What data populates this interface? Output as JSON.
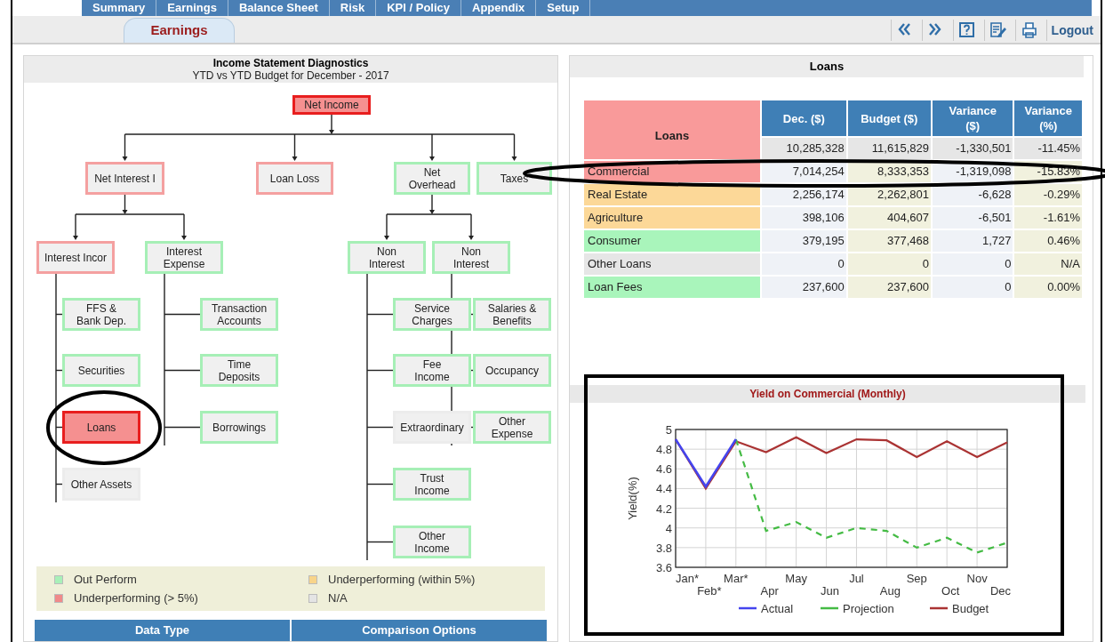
{
  "nav_tabs": [
    "Summary",
    "Earnings",
    "Balance Sheet",
    "Risk",
    "KPI / Policy",
    "Appendix",
    "Setup"
  ],
  "sub_tab": {
    "label": "Earnings",
    "selected": true
  },
  "toolbar": {
    "buttons": [
      {
        "kind": "prev"
      },
      {
        "kind": "next"
      },
      {
        "kind": "help"
      },
      {
        "kind": "edit"
      },
      {
        "kind": "print"
      }
    ],
    "logout": "Logout"
  },
  "diagnostics": {
    "title": "Income Statement Diagnostics",
    "subtitle": "YTD vs YTD Budget for December - 2017",
    "tree": {
      "label": "Net Income",
      "color": "#e81e1e",
      "highlighted": true,
      "children": [
        {
          "label": "Net Interest I",
          "color": "#f4a0a0",
          "highlighted": false,
          "children": [
            {
              "label": "Interest Incor",
              "color": "#f4a0a0",
              "highlighted": false,
              "children": [
                {
                  "label": "FFS &\nBank Dep.",
                  "color": "#a6efb6",
                  "highlighted": false
                },
                {
                  "label": "Securities",
                  "color": "#a6efb6",
                  "highlighted": false
                },
                {
                  "label": "Loans",
                  "color": "#e81e1e",
                  "highlighted": true
                },
                {
                  "label": "Other Assets",
                  "color": "#ececec",
                  "highlighted": false
                }
              ]
            },
            {
              "label": "Interest\nExpense",
              "color": "#a6efb6",
              "highlighted": false,
              "children": [
                {
                  "label": "Transaction\nAccounts",
                  "color": "#a6efb6",
                  "highlighted": false
                },
                {
                  "label": "Time\nDeposits",
                  "color": "#a6efb6",
                  "highlighted": false
                },
                {
                  "label": "Borrowings",
                  "color": "#a6efb6",
                  "highlighted": false
                }
              ]
            }
          ]
        },
        {
          "label": "Loan Loss",
          "color": "#f4a0a0",
          "highlighted": false
        },
        {
          "label": "Net\nOverhead",
          "color": "#a6efb6",
          "highlighted": false,
          "children": [
            {
              "label": "Non\nInterest",
              "color": "#a6efb6",
              "highlighted": false,
              "children": [
                {
                  "label": "Service\nCharges",
                  "color": "#a6efb6",
                  "highlighted": false
                },
                {
                  "label": "Fee\nIncome",
                  "color": "#a6efb6",
                  "highlighted": false
                },
                {
                  "label": "Extraordinary",
                  "color": "#ececec",
                  "highlighted": false
                },
                {
                  "label": "Trust\nIncome",
                  "color": "#a6efb6",
                  "highlighted": false
                },
                {
                  "label": "Other\nIncome",
                  "color": "#a6efb6",
                  "highlighted": false
                }
              ]
            },
            {
              "label": "Non\nInterest",
              "color": "#a6efb6",
              "highlighted": false,
              "children": [
                {
                  "label": "Salaries &\nBenefits",
                  "color": "#a6efb6",
                  "highlighted": false
                },
                {
                  "label": "Occupancy",
                  "color": "#a6efb6",
                  "highlighted": false
                },
                {
                  "label": "Other\nExpense",
                  "color": "#a6efb6",
                  "highlighted": false
                }
              ]
            }
          ]
        },
        {
          "label": "Taxes",
          "color": "#a6efb6",
          "highlighted": false
        }
      ]
    },
    "legend": [
      {
        "label": "Out Perform",
        "color": "#a8f0b8"
      },
      {
        "label": "Underperforming (within 5%)",
        "color": "#f8d48a"
      },
      {
        "label": "Underperforming (> 5%)",
        "color": "#f08a8a"
      },
      {
        "label": "N/A",
        "color": "#e4e4e4"
      }
    ],
    "bottom_headers": [
      "Data Type",
      "Comparison Options"
    ]
  },
  "loans": {
    "title": "Loans",
    "table": {
      "corner": "Loans",
      "columns": [
        "Dec. ($)",
        "Budget ($)",
        "Variance\n($)",
        "Variance\n(%)"
      ],
      "total": [
        "10,285,328",
        "11,615,829",
        "-1,330,501",
        "-11.45%"
      ],
      "rows": [
        {
          "label": "Commercial",
          "color": "#f99a9a",
          "cells": [
            "7,014,254",
            "8,333,353",
            "-1,319,098",
            "-15.83%"
          ]
        },
        {
          "label": "Real Estate",
          "color": "#fcd898",
          "cells": [
            "2,256,174",
            "2,262,801",
            "-6,628",
            "-0.29%"
          ]
        },
        {
          "label": "Agriculture",
          "color": "#fcd898",
          "cells": [
            "398,106",
            "404,607",
            "-6,501",
            "-1.61%"
          ]
        },
        {
          "label": "Consumer",
          "color": "#a9f5bb",
          "cells": [
            "379,195",
            "377,468",
            "1,727",
            "0.46%"
          ]
        },
        {
          "label": "Other Loans",
          "color": "#e6e6e6",
          "cells": [
            "0",
            "0",
            "0",
            "N/A"
          ]
        },
        {
          "label": "Loan Fees",
          "color": "#a9f5bb",
          "cells": [
            "237,600",
            "237,600",
            "0",
            "0.00%"
          ]
        }
      ]
    }
  },
  "chart_panel": {
    "title": "Yield on Commercial (Monthly)",
    "chart_data": {
      "type": "line",
      "ylabel": "Yield(%)",
      "categories": [
        "Jan*",
        "Feb*",
        "Mar*",
        "Apr",
        "May",
        "Jun",
        "Jul",
        "Aug",
        "Sep",
        "Oct",
        "Nov",
        "Dec"
      ],
      "ylim": [
        3.6,
        5
      ],
      "yticks": [
        3.6,
        3.8,
        4,
        4.2,
        4.4,
        4.6,
        4.8,
        5
      ],
      "grid": true,
      "legend": true,
      "series": [
        {
          "name": "Actual",
          "color": "#4444ee",
          "line_style": "solid",
          "values": [
            4.9,
            4.42,
            4.9,
            null,
            null,
            null,
            null,
            null,
            null,
            null,
            null,
            null
          ]
        },
        {
          "name": "Projection",
          "color": "#44bb44",
          "line_style": "dashed",
          "values": [
            null,
            null,
            4.9,
            3.97,
            4.06,
            3.9,
            4.0,
            3.97,
            3.8,
            3.9,
            3.75,
            3.85
          ]
        },
        {
          "name": "Budget",
          "color": "#aa3333",
          "line_style": "solid",
          "values": [
            4.9,
            4.4,
            4.88,
            4.77,
            4.92,
            4.76,
            4.9,
            4.89,
            4.72,
            4.88,
            4.72,
            4.87
          ]
        }
      ]
    }
  },
  "annotations": [
    {
      "kind": "ellipse"
    },
    {
      "kind": "ellipse"
    },
    {
      "kind": "rectangle"
    }
  ]
}
